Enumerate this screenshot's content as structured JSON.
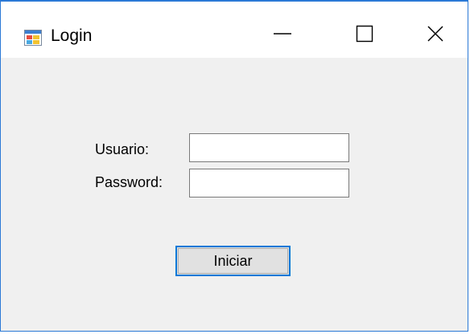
{
  "window": {
    "title": "Login",
    "icon": "windows-form-icon",
    "accent_color": "#2b79d6"
  },
  "titlebar": {
    "minimize_icon": "minimize-icon",
    "maximize_icon": "maximize-icon",
    "close_icon": "close-icon"
  },
  "form": {
    "user_label": "Usuario:",
    "user_value": "",
    "password_label": "Password:",
    "password_value": "",
    "submit_label": "Iniciar"
  }
}
